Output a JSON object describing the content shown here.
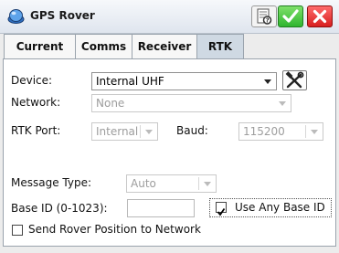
{
  "window": {
    "title": "GPS Rover"
  },
  "tabs": [
    {
      "label": "Current"
    },
    {
      "label": "Comms"
    },
    {
      "label": "Receiver"
    },
    {
      "label": "RTK"
    }
  ],
  "form": {
    "device_label": "Device:",
    "device_value": "Internal UHF",
    "network_label": "Network:",
    "network_value": "None",
    "rtk_port_label": "RTK Port:",
    "rtk_port_value": "Internal",
    "baud_label": "Baud:",
    "baud_value": "115200",
    "message_type_label": "Message Type:",
    "message_type_value": "Auto",
    "base_id_label": "Base ID (0-1023):",
    "base_id_value": "",
    "use_any_base_label": "Use Any Base ID",
    "use_any_base_checked": true,
    "send_position_label": "Send Rover Position to Network",
    "send_position_checked": false
  },
  "colors": {
    "ok": "#2fb52f",
    "cancel": "#d81f1f",
    "active_tab": "#cfd9e3"
  },
  "icons": [
    "gps-rover-icon",
    "help-icon",
    "check-icon",
    "close-icon",
    "tools-icon",
    "chevron-down-icon"
  ]
}
